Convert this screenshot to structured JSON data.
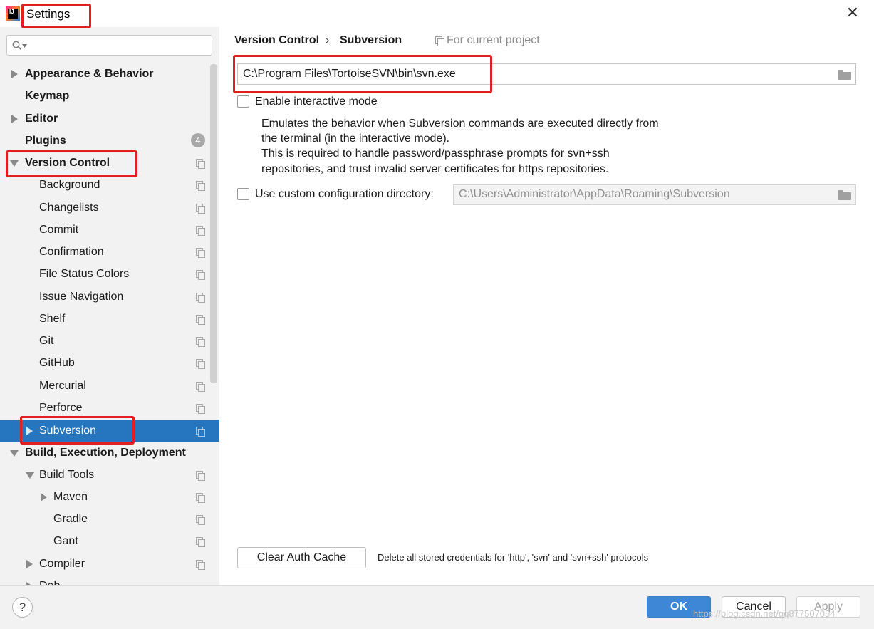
{
  "window": {
    "title": "Settings",
    "close_glyph": "✕"
  },
  "search": {
    "placeholder": ""
  },
  "sidebar": {
    "items": [
      {
        "label": "Appearance & Behavior"
      },
      {
        "label": "Keymap"
      },
      {
        "label": "Editor"
      },
      {
        "label": "Plugins",
        "badge": "4"
      },
      {
        "label": "Version Control"
      },
      {
        "label": "Background"
      },
      {
        "label": "Changelists"
      },
      {
        "label": "Commit"
      },
      {
        "label": "Confirmation"
      },
      {
        "label": "File Status Colors"
      },
      {
        "label": "Issue Navigation"
      },
      {
        "label": "Shelf"
      },
      {
        "label": "Git"
      },
      {
        "label": "GitHub"
      },
      {
        "label": "Mercurial"
      },
      {
        "label": "Perforce"
      },
      {
        "label": "Subversion"
      },
      {
        "label": "Build, Execution, Deployment"
      },
      {
        "label": "Build Tools"
      },
      {
        "label": "Maven"
      },
      {
        "label": "Gradle"
      },
      {
        "label": "Gant"
      },
      {
        "label": "Compiler"
      },
      {
        "label": "Deb"
      }
    ]
  },
  "breadcrumb": {
    "parent": "Version Control",
    "separator": "›",
    "current": "Subversion",
    "scope": "For current project"
  },
  "main": {
    "svn_path": "C:\\Program Files\\TortoiseSVN\\bin\\svn.exe",
    "interactive": {
      "label": "Enable interactive mode",
      "desc_1": "Emulates the behavior when Subversion commands are executed directly from",
      "desc_2": "the terminal (in the interactive mode).",
      "desc_3": "This is required to handle password/passphrase prompts for svn+ssh",
      "desc_4": "repositories, and trust invalid server certificates for https repositories."
    },
    "custom_config": {
      "label": "Use custom configuration directory:",
      "path": "C:\\Users\\Administrator\\AppData\\Roaming\\Subversion"
    },
    "clear_auth": {
      "label": "Clear Auth Cache",
      "desc": "Delete all stored credentials for 'http', 'svn' and 'svn+ssh' protocols"
    }
  },
  "footer": {
    "help": "?",
    "ok": "OK",
    "cancel": "Cancel",
    "apply": "Apply",
    "watermark": "https://blog.csdn.net/qq877507054"
  },
  "colors": {
    "selection": "#2675bf",
    "primary_button": "#3d87d6",
    "highlight_box": "#e02020"
  }
}
